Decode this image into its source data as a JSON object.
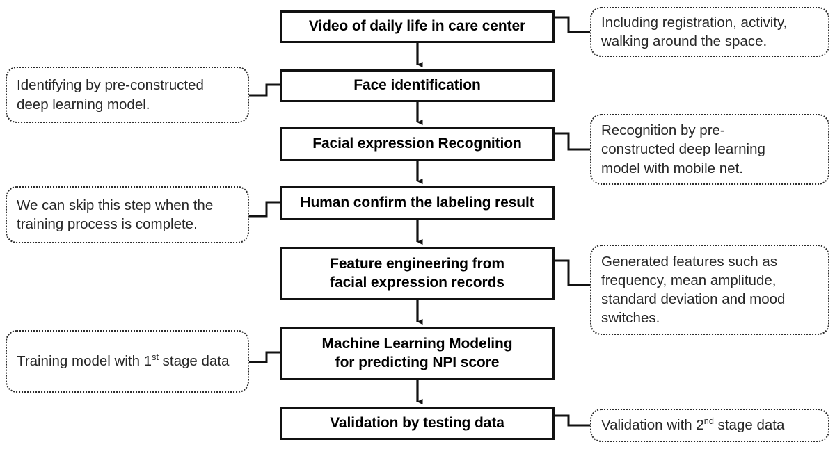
{
  "diagram": {
    "title": "Facial expression analysis pipeline flowchart",
    "colors": {
      "box_border": "#111111",
      "note_border": "#2b2b2b",
      "arrow": "#111111",
      "background": "#ffffff",
      "text": "#000000"
    },
    "steps": [
      {
        "id": "step-1",
        "label": "Video of daily life in care center",
        "lines": [
          "Video of daily life in care center"
        ]
      },
      {
        "id": "step-2",
        "label": "Face identification",
        "lines": [
          "Face identification"
        ]
      },
      {
        "id": "step-3",
        "label": "Facial expression Recognition",
        "lines": [
          "Facial expression Recognition"
        ]
      },
      {
        "id": "step-4",
        "label": "Human confirm the labeling result",
        "lines": [
          "Human confirm the labeling result"
        ]
      },
      {
        "id": "step-5",
        "label": "Feature engineering from facial expression records",
        "lines": [
          "Feature engineering from",
          "facial expression records"
        ]
      },
      {
        "id": "step-6",
        "label": "Machine Learning Modeling for predicting NPI score",
        "lines": [
          "Machine Learning Modeling",
          "for predicting NPI score"
        ]
      },
      {
        "id": "step-7",
        "label": "Validation by testing data",
        "lines": [
          "Validation by testing data"
        ]
      }
    ],
    "notes": [
      {
        "id": "note-1",
        "side": "right",
        "attached_to": "step-1",
        "text": "Including registration, activity, walking around the space.",
        "lines": [
          "Including registration, activity,",
          "walking around the space."
        ]
      },
      {
        "id": "note-2",
        "side": "left",
        "attached_to": "step-2",
        "text": "Identifying by pre-constructed deep learning model.",
        "lines": [
          "Identifying by pre-constructed",
          "deep learning model."
        ]
      },
      {
        "id": "note-3",
        "side": "right",
        "attached_to": "step-3",
        "text": "Recognition by pre-constructed deep learning model with mobile net.",
        "lines": [
          "Recognition by pre-",
          "constructed deep learning",
          "model with mobile net."
        ]
      },
      {
        "id": "note-4",
        "side": "left",
        "attached_to": "step-4",
        "text": "We can skip this step when the training process is complete.",
        "lines": [
          "We can skip this step when the",
          "training process is complete."
        ]
      },
      {
        "id": "note-5",
        "side": "right",
        "attached_to": "step-5",
        "text": "Generated features such as frequency, mean amplitude, standard deviation and mood switches.",
        "lines": [
          "Generated features such as",
          "frequency, mean amplitude,",
          "standard deviation and mood",
          "switches."
        ]
      },
      {
        "id": "note-6",
        "side": "left",
        "attached_to": "step-6",
        "text_pre": "Training model with 1",
        "text_sup": "st",
        "text_post": " stage data",
        "text": "Training model with 1st stage data"
      },
      {
        "id": "note-7",
        "side": "right",
        "attached_to": "step-7",
        "text_pre": "Validation with 2",
        "text_sup": "nd",
        "text_post": " stage data",
        "text": "Validation with 2nd stage data"
      }
    ],
    "arrows": [
      {
        "from": "step-1",
        "to": "step-2"
      },
      {
        "from": "step-2",
        "to": "step-3"
      },
      {
        "from": "step-3",
        "to": "step-4"
      },
      {
        "from": "step-4",
        "to": "step-5"
      },
      {
        "from": "step-5",
        "to": "step-6"
      },
      {
        "from": "step-6",
        "to": "step-7"
      }
    ]
  }
}
